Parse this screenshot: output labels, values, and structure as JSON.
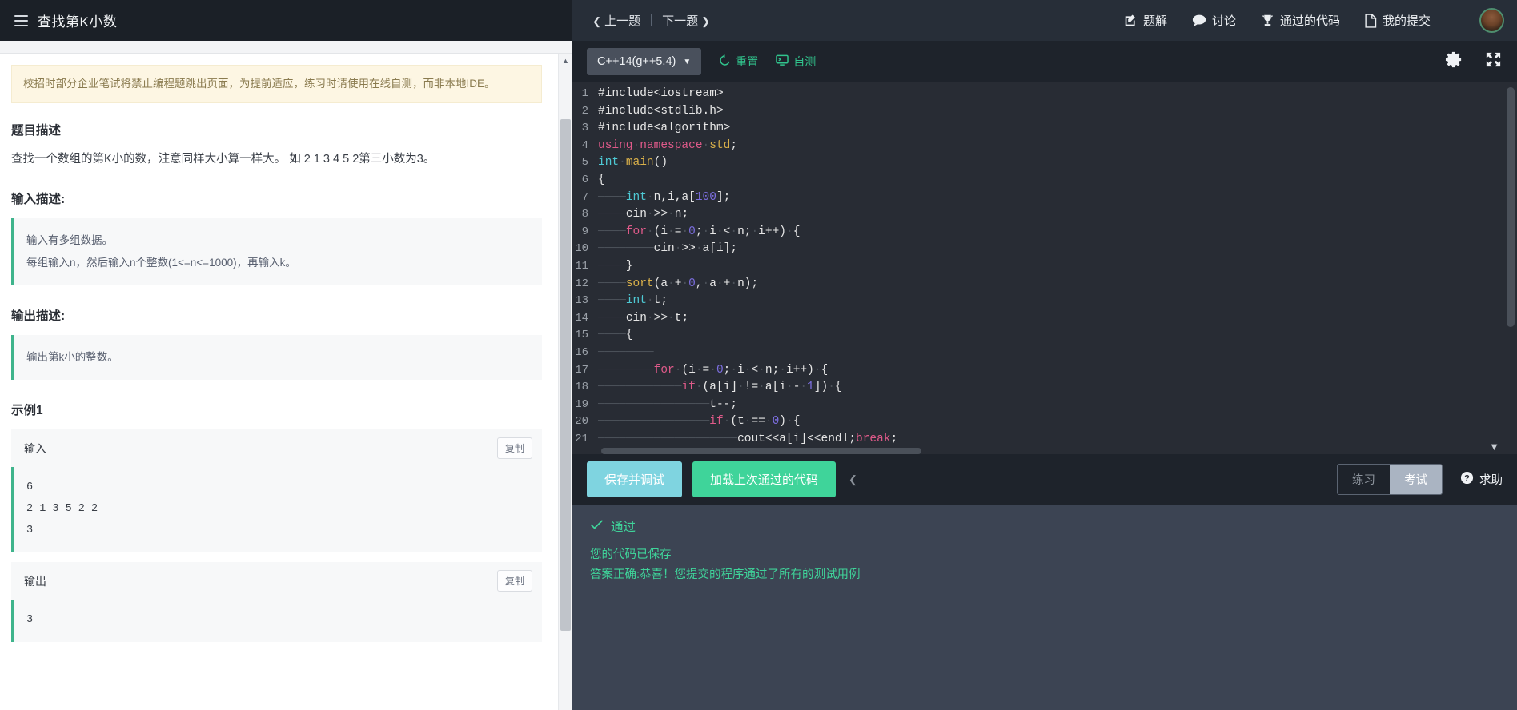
{
  "header": {
    "title": "查找第K小数",
    "menu_icon": "hamburger-icon",
    "prev_label": "上一题",
    "next_label": "下一题",
    "actions": [
      {
        "label": "题解",
        "icon": "edit-square-icon"
      },
      {
        "label": "讨论",
        "icon": "speech-bubble-icon"
      },
      {
        "label": "通过的代码",
        "icon": "trophy-icon"
      },
      {
        "label": "我的提交",
        "icon": "file-icon"
      }
    ],
    "avatar": "user-avatar"
  },
  "left": {
    "notice": "校招时部分企业笔试将禁止编程题跳出页面，为提前适应，练习时请使用在线自测，而非本地IDE。",
    "desc_heading": "题目描述",
    "desc_body": "查找一个数组的第K小的数，注意同样大小算一样大。 如 2 1 3 4 5 2第三小数为3。",
    "input_heading": "输入描述:",
    "input_lines": [
      "输入有多组数据。",
      "每组输入n，然后输入n个整数(1<=n<=1000)，再输入k。"
    ],
    "output_heading": "输出描述:",
    "output_lines": [
      "输出第k小的整数。"
    ],
    "example_heading": "示例1",
    "example_input_label": "输入",
    "example_output_label": "输出",
    "copy_label": "复制",
    "example_input": "6\n2 1 3 5 2 2\n3",
    "example_output": "3"
  },
  "editor": {
    "language": "C++14(g++5.4)",
    "reset_label": "重置",
    "selftest_label": "自测",
    "gear_icon": "gear-icon",
    "fullscreen_icon": "fullscreen-icon",
    "code_lines": [
      {
        "no": 1,
        "text": "#include<iostream>"
      },
      {
        "no": 2,
        "text": "#include<stdlib.h>"
      },
      {
        "no": 3,
        "text": "#include<algorithm>"
      },
      {
        "no": 4,
        "text": "using namespace std;"
      },
      {
        "no": 5,
        "text": "int main()"
      },
      {
        "no": 6,
        "text": "{"
      },
      {
        "no": 7,
        "text": "    int n,i,a[100];"
      },
      {
        "no": 8,
        "text": "    cin >> n;"
      },
      {
        "no": 9,
        "text": "    for (i = 0; i < n; i++) {"
      },
      {
        "no": 10,
        "text": "        cin >> a[i];"
      },
      {
        "no": 11,
        "text": "    }"
      },
      {
        "no": 12,
        "text": "    sort(a + 0, a + n);"
      },
      {
        "no": 13,
        "text": "    int t;"
      },
      {
        "no": 14,
        "text": "    cin >> t;"
      },
      {
        "no": 15,
        "text": "    {"
      },
      {
        "no": 16,
        "text": "        "
      },
      {
        "no": 17,
        "text": "        for (i = 0; i < n; i++) {"
      },
      {
        "no": 18,
        "text": "            if (a[i] != a[i - 1]) {"
      },
      {
        "no": 19,
        "text": "                t--;"
      },
      {
        "no": 20,
        "text": "                if (t == 0) {"
      },
      {
        "no": 21,
        "text": "                    cout<<a[i]<<endl;break;"
      }
    ]
  },
  "actions": {
    "save_debug_label": "保存并调试",
    "load_passed_label": "加载上次通过的代码",
    "collapse_icon": "chevron-left-icon",
    "mode_practice": "练习",
    "mode_exam": "考试",
    "help_label": "求助",
    "help_icon": "question-circle-icon"
  },
  "status": {
    "check_icon": "check-icon",
    "result": "通过",
    "lines": [
      "您的代码已保存",
      "答案正确:恭喜！您提交的程序通过了所有的测试用例"
    ]
  },
  "colors": {
    "accent_green": "#3fd49a",
    "accent_cyan": "#7fd4e0",
    "header_bg": "#272e38",
    "editor_bg": "#282c34",
    "status_bg": "#3c4453"
  }
}
